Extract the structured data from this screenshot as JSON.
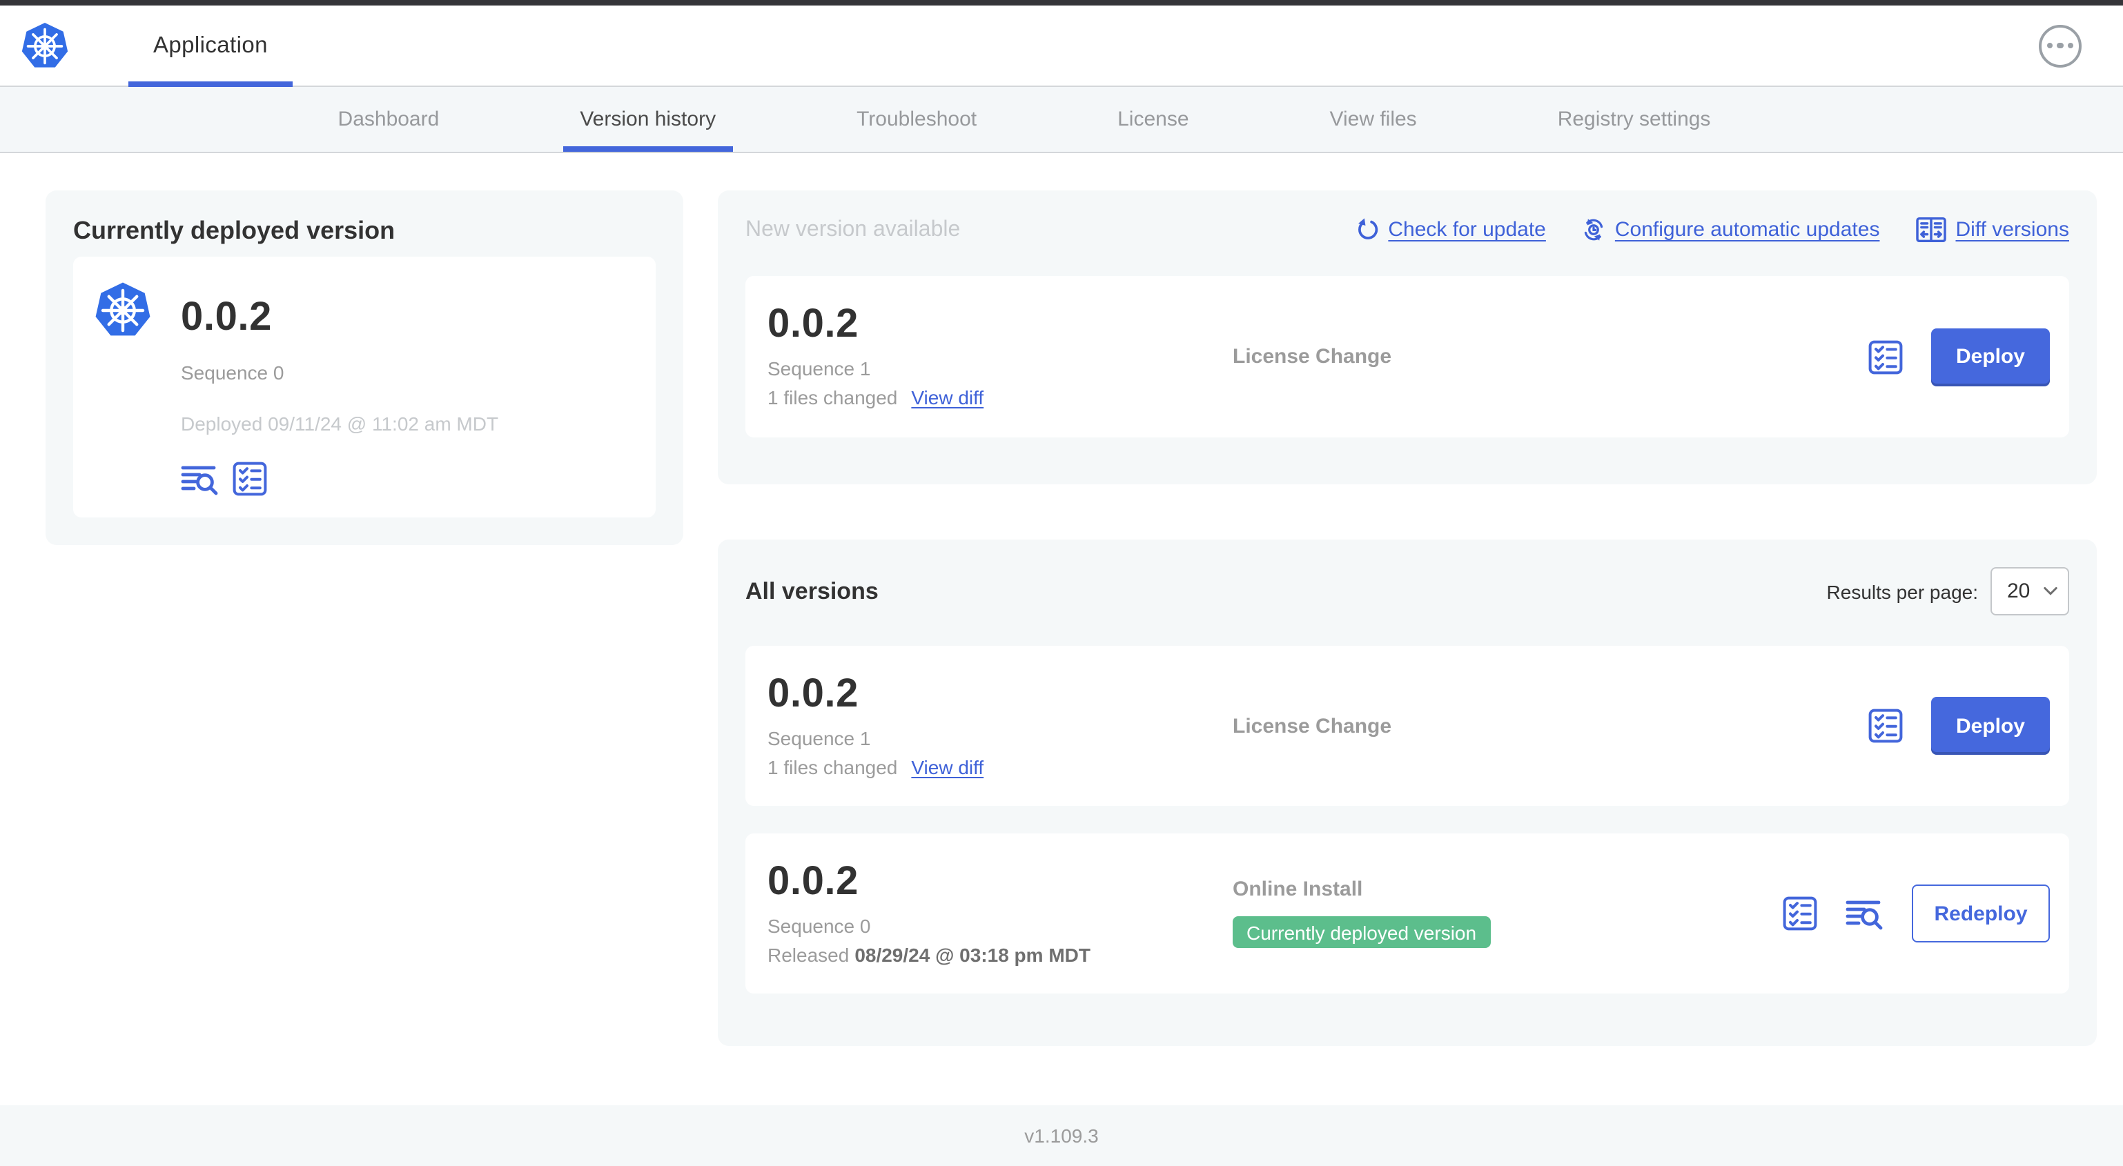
{
  "header": {
    "app_label": "Application"
  },
  "nav": {
    "tabs": [
      "Dashboard",
      "Version history",
      "Troubleshoot",
      "License",
      "View files",
      "Registry settings"
    ]
  },
  "current_version_panel": {
    "title": "Currently deployed version",
    "version": "0.0.2",
    "sequence": "Sequence 0",
    "deployed_timestamp": "Deployed 09/11/24 @ 11:02 am MDT"
  },
  "new_version_panel": {
    "title": "New version available",
    "check_for_update_label": "Check for update",
    "configure_updates_label": "Configure automatic updates",
    "diff_versions_label": "Diff versions",
    "card": {
      "version": "0.0.2",
      "sequence": "Sequence 1",
      "files_changed": "1 files changed",
      "view_diff_label": "View diff",
      "source": "License Change",
      "deploy_label": "Deploy"
    }
  },
  "all_versions_panel": {
    "title": "All versions",
    "results_per_page_label": "Results per page:",
    "results_per_page_value": "20",
    "rows": [
      {
        "version": "0.0.2",
        "sequence": "Sequence 1",
        "files_changed": "1 files changed",
        "view_diff_label": "View diff",
        "source": "License Change",
        "action_label": "Deploy"
      },
      {
        "version": "0.0.2",
        "sequence": "Sequence 0",
        "released_prefix": "Released",
        "released_date": "08/29/24 @ 03:18 pm MDT",
        "source": "Online Install",
        "badge": "Currently deployed version",
        "action_label": "Redeploy"
      }
    ]
  },
  "footer": {
    "app_version": "v1.109.3"
  },
  "icons": {
    "logo": "kubernetes-logo",
    "menu": "ellipsis-icon",
    "check_update": "refresh-icon",
    "configure_updates": "scheduled-update-icon",
    "diff": "diff-columns-icon",
    "logs": "deploy-logs-icon",
    "preflight": "preflight-checklist-icon",
    "select": "chevron-down-icon"
  },
  "colors": {
    "primary_blue": "#4568dd",
    "link_blue": "#3e61d8",
    "kubernetes_blue": "#326de6",
    "badge_green": "#5cbe8c",
    "panel_gray": "#f5f8f9",
    "text_dark": "#323232",
    "text_gray": "#9b9b9b",
    "text_light": "#c6c9cc"
  }
}
